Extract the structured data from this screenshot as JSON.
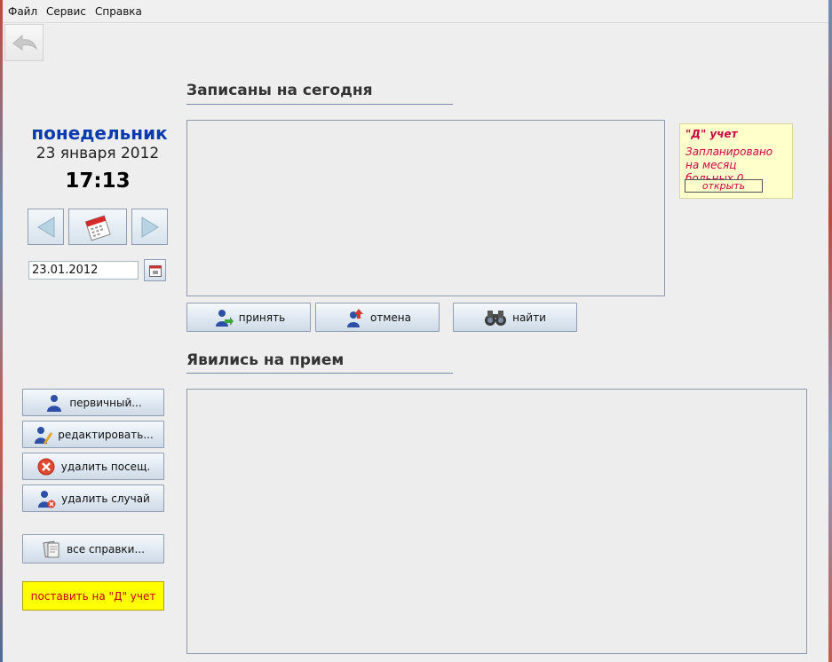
{
  "menu": {
    "items": [
      "Файл",
      "Сервис",
      "Справка"
    ]
  },
  "toolbar": {
    "back_icon": "back-arrow-icon"
  },
  "date_panel": {
    "weekday": "понедельник",
    "date_text": "23 января 2012",
    "time": "17:13",
    "date_value": "23.01.2012"
  },
  "scheduled": {
    "title": "Записаны на сегодня",
    "accept_label": "принять",
    "cancel_label": "отмена",
    "find_label": "найти"
  },
  "dcard": {
    "title": "\"Д\" учет",
    "text": "Запланировано на месяц больных 0",
    "open_label": "открыть"
  },
  "attended": {
    "title": "Явились на прием"
  },
  "actions": {
    "primary_label": "первичный...",
    "edit_label": "редактировать...",
    "delete_visit_label": "удалить посещ.",
    "delete_case_label": "удалить случай",
    "all_refs_label": "все справки...",
    "d_register_label": "поставить на \"Д\" учет"
  },
  "colors": {
    "weekday": "#0a3ab0",
    "accent_red": "#cc0044",
    "yellow": "#ffff00"
  }
}
